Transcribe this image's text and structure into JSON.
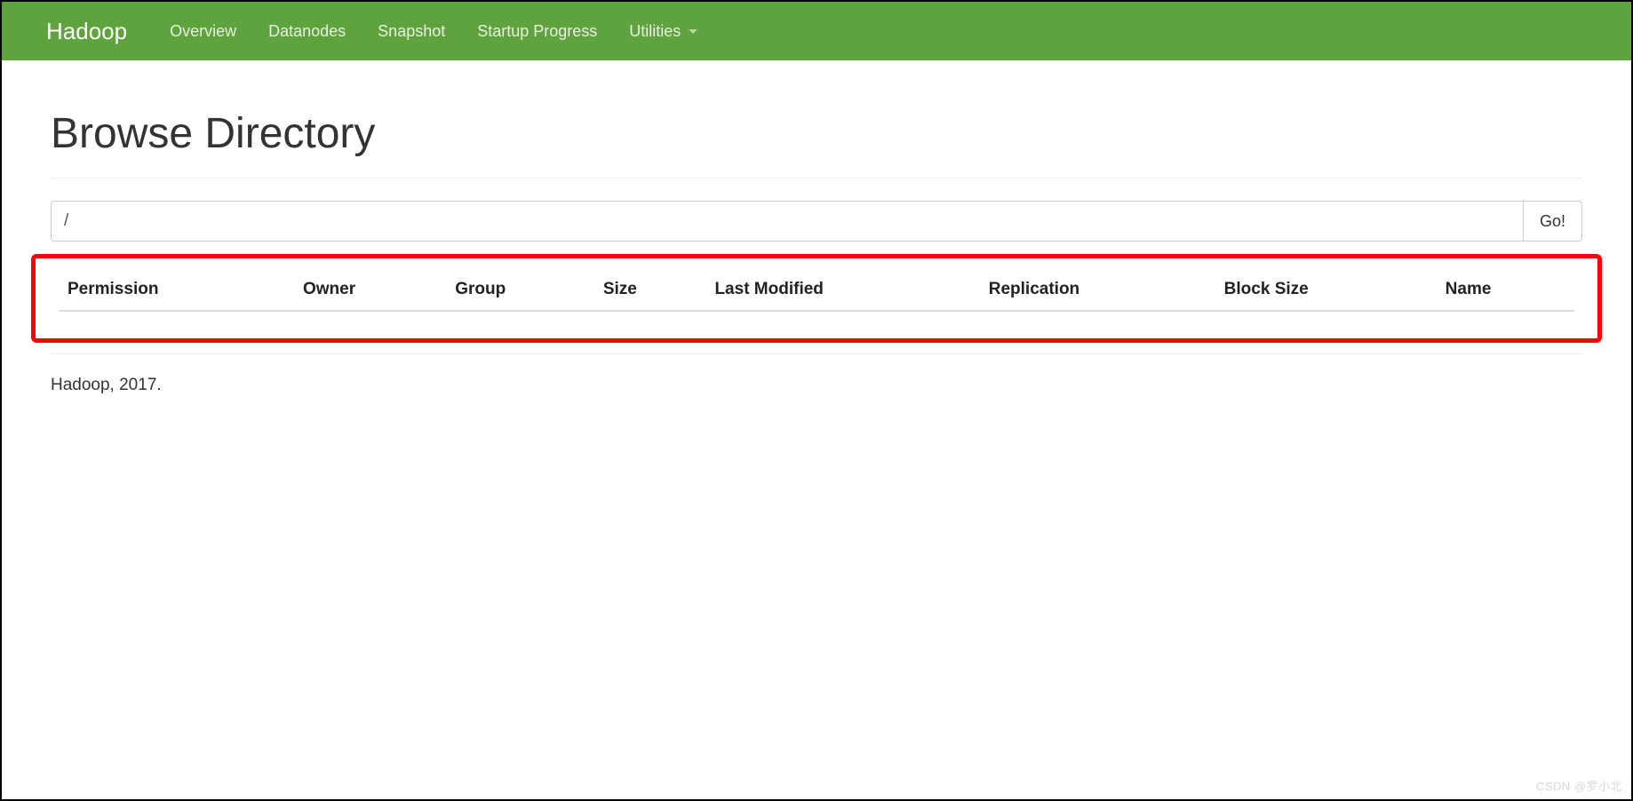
{
  "navbar": {
    "brand": "Hadoop",
    "items": [
      {
        "label": "Overview"
      },
      {
        "label": "Datanodes"
      },
      {
        "label": "Snapshot"
      },
      {
        "label": "Startup Progress"
      },
      {
        "label": "Utilities",
        "dropdown": true
      }
    ]
  },
  "page": {
    "title": "Browse Directory"
  },
  "browse": {
    "path_value": "/",
    "go_label": "Go!"
  },
  "table": {
    "columns": [
      "Permission",
      "Owner",
      "Group",
      "Size",
      "Last Modified",
      "Replication",
      "Block Size",
      "Name"
    ],
    "rows": []
  },
  "footer": {
    "text": "Hadoop, 2017."
  },
  "watermark": {
    "text": "CSDN @罗小北"
  }
}
